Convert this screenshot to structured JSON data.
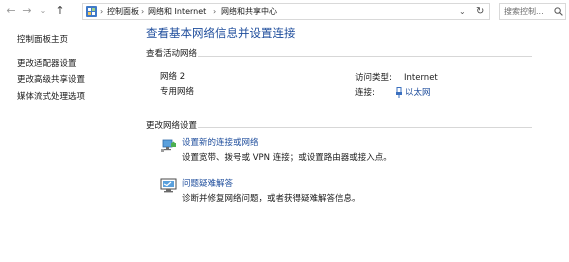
{
  "address_bar": {
    "crumbs": [
      "控制面板",
      "网络和 Internet",
      "网络和共享中心"
    ],
    "search_placeholder": "搜索控制..."
  },
  "sidebar": {
    "items": [
      {
        "label": "控制面板主页"
      },
      {
        "label": "更改适配器设置"
      },
      {
        "label": "更改高级共享设置"
      },
      {
        "label": "媒体流式处理选项"
      }
    ]
  },
  "main": {
    "title": "查看基本网络信息并设置连接",
    "active_section": "查看活动网络",
    "network": {
      "name": "网络 2",
      "type": "专用网络",
      "access_type_label": "访问类型:",
      "access_type_value": "Internet",
      "connection_label": "连接:",
      "connection_value": "以太网"
    },
    "change_section": "更改网络设置",
    "tasks": [
      {
        "title": "设置新的连接或网络",
        "desc": "设置宽带、拨号或 VPN 连接；或设置路由器或接入点。",
        "icon": "network-setup-icon"
      },
      {
        "title": "问题疑难解答",
        "desc": "诊断并修复网络问题，或者获得疑难解答信息。",
        "icon": "troubleshoot-icon"
      }
    ]
  }
}
